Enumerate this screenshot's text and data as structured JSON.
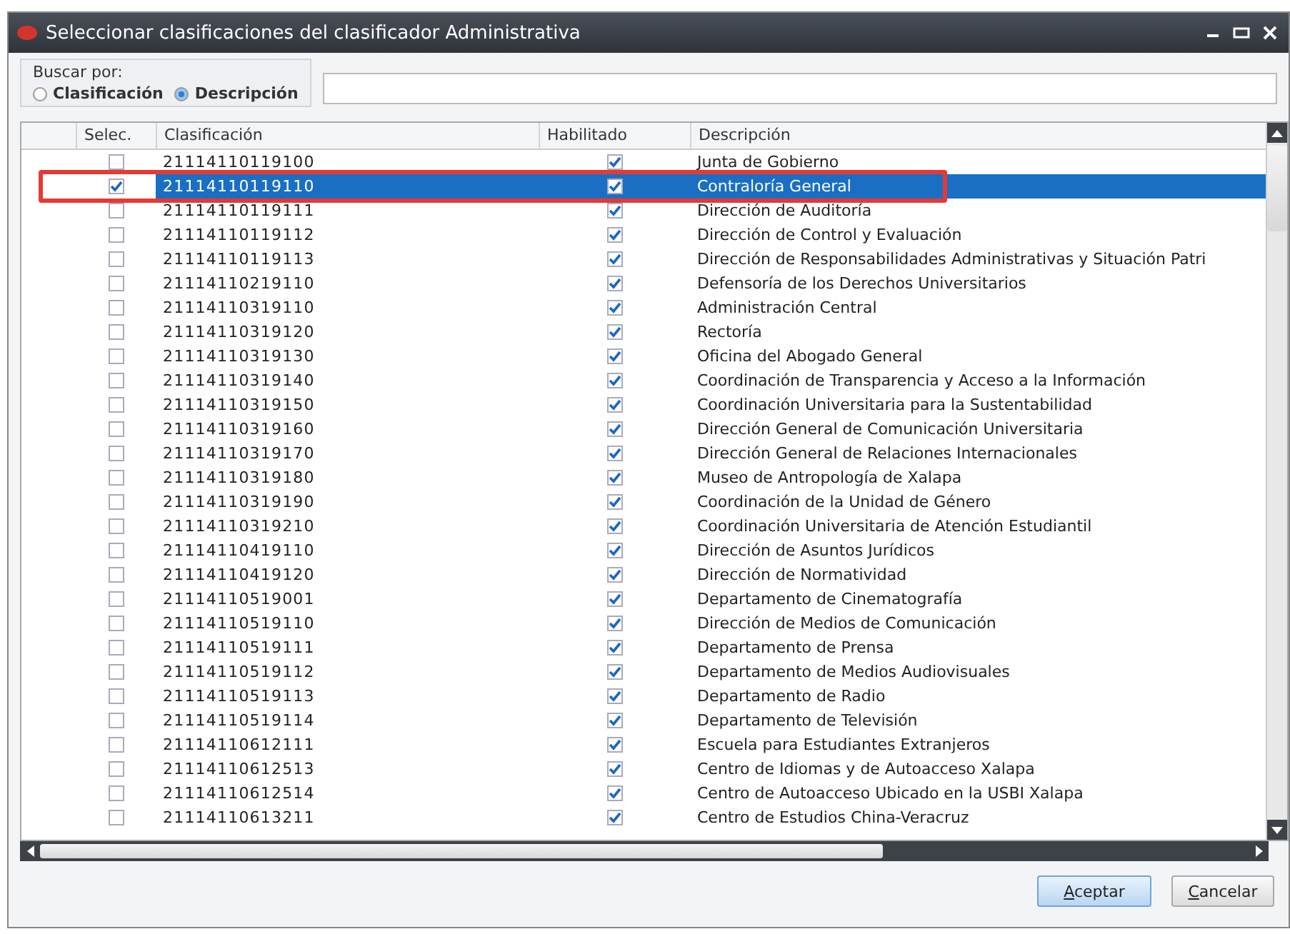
{
  "window": {
    "title": "Seleccionar clasificaciones del clasificador Administrativa"
  },
  "search": {
    "label": "Buscar por:",
    "options": [
      {
        "label": "Clasificación",
        "selected": false
      },
      {
        "label": "Descripción",
        "selected": true
      }
    ]
  },
  "table": {
    "columns": [
      "Selec.",
      "Clasificación",
      "Habilitado",
      "Descripción"
    ],
    "rows": [
      {
        "code": "21114110119100",
        "enabled": true,
        "checked": false,
        "selected": false,
        "description": "Junta de Gobierno"
      },
      {
        "code": "21114110119110",
        "enabled": true,
        "checked": true,
        "selected": true,
        "highlighted": true,
        "description": "Contraloría General"
      },
      {
        "code": "21114110119111",
        "enabled": true,
        "checked": false,
        "selected": false,
        "description": "Dirección de Auditoría"
      },
      {
        "code": "21114110119112",
        "enabled": true,
        "checked": false,
        "selected": false,
        "description": "Dirección de Control y Evaluación"
      },
      {
        "code": "21114110119113",
        "enabled": true,
        "checked": false,
        "selected": false,
        "description": "Dirección de Responsabilidades Administrativas y Situación Patri"
      },
      {
        "code": "21114110219110",
        "enabled": true,
        "checked": false,
        "selected": false,
        "description": "Defensoría de los Derechos Universitarios"
      },
      {
        "code": "21114110319110",
        "enabled": true,
        "checked": false,
        "selected": false,
        "description": "Administración Central"
      },
      {
        "code": "21114110319120",
        "enabled": true,
        "checked": false,
        "selected": false,
        "description": "Rectoría"
      },
      {
        "code": "21114110319130",
        "enabled": true,
        "checked": false,
        "selected": false,
        "description": "Oficina del Abogado General"
      },
      {
        "code": "21114110319140",
        "enabled": true,
        "checked": false,
        "selected": false,
        "description": "Coordinación de Transparencia y Acceso a la Información"
      },
      {
        "code": "21114110319150",
        "enabled": true,
        "checked": false,
        "selected": false,
        "description": "Coordinación Universitaria para la Sustentabilidad"
      },
      {
        "code": "21114110319160",
        "enabled": true,
        "checked": false,
        "selected": false,
        "description": "Dirección General de Comunicación Universitaria"
      },
      {
        "code": "21114110319170",
        "enabled": true,
        "checked": false,
        "selected": false,
        "description": "Dirección General de Relaciones Internacionales"
      },
      {
        "code": "21114110319180",
        "enabled": true,
        "checked": false,
        "selected": false,
        "description": "Museo de Antropología de Xalapa"
      },
      {
        "code": "21114110319190",
        "enabled": true,
        "checked": false,
        "selected": false,
        "description": "Coordinación de la Unidad de Género"
      },
      {
        "code": "21114110319210",
        "enabled": true,
        "checked": false,
        "selected": false,
        "description": "Coordinación Universitaria de Atención Estudiantil"
      },
      {
        "code": "21114110419110",
        "enabled": true,
        "checked": false,
        "selected": false,
        "description": "Dirección de Asuntos Jurídicos"
      },
      {
        "code": "21114110419120",
        "enabled": true,
        "checked": false,
        "selected": false,
        "description": "Dirección de Normatividad"
      },
      {
        "code": "21114110519001",
        "enabled": true,
        "checked": false,
        "selected": false,
        "description": "Departamento de Cinematografía"
      },
      {
        "code": "21114110519110",
        "enabled": true,
        "checked": false,
        "selected": false,
        "description": "Dirección de Medios de Comunicación"
      },
      {
        "code": "21114110519111",
        "enabled": true,
        "checked": false,
        "selected": false,
        "description": "Departamento de Prensa"
      },
      {
        "code": "21114110519112",
        "enabled": true,
        "checked": false,
        "selected": false,
        "description": "Departamento de Medios Audiovisuales"
      },
      {
        "code": "21114110519113",
        "enabled": true,
        "checked": false,
        "selected": false,
        "description": "Departamento de Radio"
      },
      {
        "code": "21114110519114",
        "enabled": true,
        "checked": false,
        "selected": false,
        "description": "Departamento de Televisión"
      },
      {
        "code": "21114110612111",
        "enabled": true,
        "checked": false,
        "selected": false,
        "description": "Escuela para Estudiantes Extranjeros"
      },
      {
        "code": "21114110612513",
        "enabled": true,
        "checked": false,
        "selected": false,
        "description": "Centro de Idiomas y de Autoacceso Xalapa"
      },
      {
        "code": "21114110612514",
        "enabled": true,
        "checked": false,
        "selected": false,
        "description": "Centro de Autoacceso Ubicado en la USBI Xalapa"
      },
      {
        "code": "21114110613211",
        "enabled": true,
        "checked": false,
        "selected": false,
        "description": "Centro de Estudios China-Veracruz"
      }
    ]
  },
  "buttons": [
    "Aceptar",
    "Cancelar"
  ]
}
